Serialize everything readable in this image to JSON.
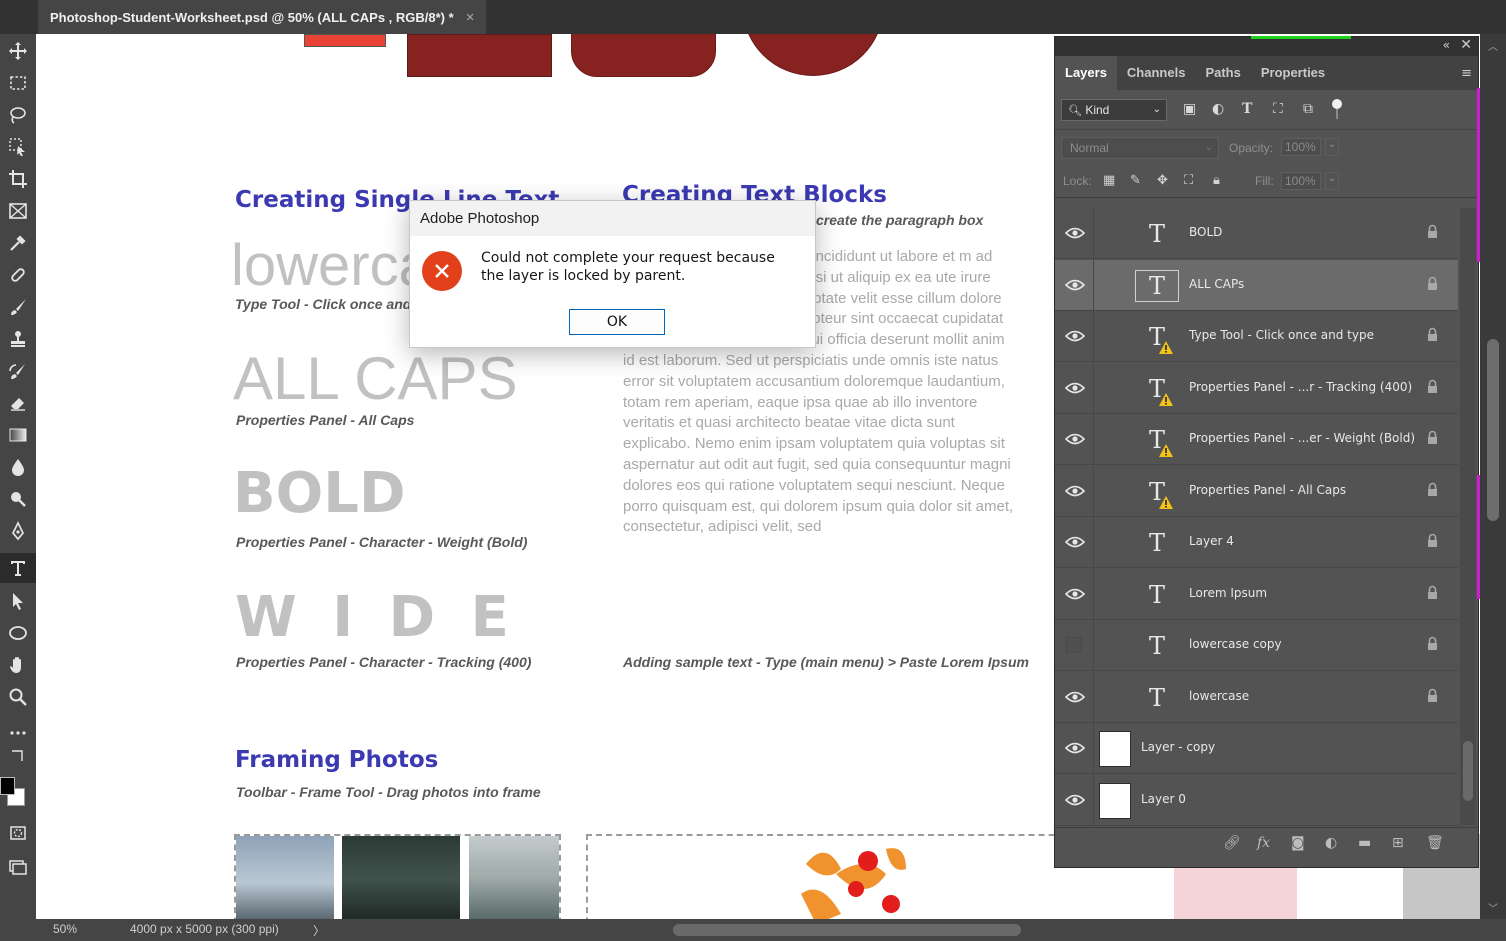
{
  "document_tab": {
    "title": "Photoshop-Student-Worksheet.psd @ 50% (ALL CAPs , RGB/8*) *",
    "close": "×"
  },
  "toolbar": {
    "tools": [
      "move-tool",
      "marquee-tool",
      "lasso-tool",
      "object-select-tool",
      "crop-tool",
      "frame-tool",
      "eyedropper-tool",
      "spot-healing-tool",
      "brush-tool",
      "clone-stamp-tool",
      "history-brush-tool",
      "eraser-tool",
      "gradient-tool",
      "blur-tool",
      "dodge-tool",
      "pen-tool",
      "type-tool",
      "path-select-tool",
      "ellipse-tool",
      "hand-tool",
      "zoom-tool",
      "more-tools",
      "swap-colors",
      "color-swatches",
      "quick-mask",
      "screen-mode"
    ],
    "active_tool": "type-tool"
  },
  "canvas": {
    "heading_single": "Creating Single Line Text",
    "heading_blocks": "Creating Text Blocks",
    "blocks_caption_top": "create the paragraph box",
    "sample_lowercase": "lowercase",
    "caption_type_tool": "Type Tool - Click once and type",
    "sample_allcaps": "ALL CAPS",
    "caption_allcaps": "Properties Panel - All Caps",
    "sample_bold": "BOLD",
    "caption_bold": "Properties Panel - Character - Weight (Bold)",
    "sample_wide": "W I D E",
    "caption_wide": "Properties Panel - Character - Tracking (400)",
    "lorem_text": "met, consectetur adipisicing incididunt ut labore et m ad minim veniam, quis laboris nisi ut aliquip ex ea ute irure dolor in reprehenderit in voluptate velit esse cillum dolore eu fugiat nulla pariatur. Excepteur sint occaecat cupidatat non proident, sunt in culpa qui officia deserunt mollit anim id est laborum. Sed ut perspiciatis unde omnis iste natus error sit voluptatem accusantium doloremque laudantium, totam rem aperiam, eaque ipsa quae ab illo inventore veritatis et quasi architecto beatae vitae dicta sunt explicabo. Nemo enim ipsam voluptatem quia voluptas sit aspernatur aut odit aut fugit, sed quia consequuntur magni dolores eos qui ratione voluptatem sequi nesciunt. Neque porro quisquam est, qui dolorem ipsum quia dolor sit amet, consectetur, adipisci velit, sed",
    "caption_lorem": "Adding sample text - Type (main menu) > Paste Lorem Ipsum",
    "heading_framing": "Framing Photos",
    "caption_framing": "Toolbar - Frame Tool - Drag photos into frame",
    "shape_color": "#862220",
    "heading_color": "#3b3ab2"
  },
  "dialog": {
    "title": "Adobe Photoshop",
    "message": "Could not complete your request because the layer is locked by parent.",
    "ok_label": "OK",
    "icon": "error-icon"
  },
  "layers_panel": {
    "tabs": [
      "Layers",
      "Channels",
      "Paths",
      "Properties"
    ],
    "active_tab": "Layers",
    "kind_label": "Kind",
    "blend_mode": "Normal",
    "opacity_label": "Opacity:",
    "opacity_value": "100%",
    "lock_label": "Lock:",
    "fill_label": "Fill:",
    "fill_value": "100%",
    "layers": [
      {
        "name": "BOLD",
        "type": "text",
        "visible": true,
        "warning": false,
        "selected": false,
        "locked": true
      },
      {
        "name": "ALL CAPs",
        "type": "text",
        "visible": true,
        "warning": false,
        "selected": true,
        "locked": true
      },
      {
        "name": "Type Tool - Click once and type",
        "type": "text",
        "visible": true,
        "warning": true,
        "selected": false,
        "locked": true
      },
      {
        "name": "Properties Panel - ...r - Tracking (400)",
        "type": "text",
        "visible": true,
        "warning": true,
        "selected": false,
        "locked": true
      },
      {
        "name": "Properties Panel - ...er - Weight (Bold)",
        "type": "text",
        "visible": true,
        "warning": true,
        "selected": false,
        "locked": true
      },
      {
        "name": "Properties Panel - All Caps",
        "type": "text",
        "visible": true,
        "warning": true,
        "selected": false,
        "locked": true
      },
      {
        "name": "Layer 4",
        "type": "text",
        "visible": true,
        "warning": false,
        "selected": false,
        "locked": true
      },
      {
        "name": "Lorem Ipsum",
        "type": "text",
        "visible": true,
        "warning": false,
        "selected": false,
        "locked": true
      },
      {
        "name": "lowercase copy",
        "type": "text",
        "visible": false,
        "warning": false,
        "selected": false,
        "locked": true
      },
      {
        "name": "lowercase",
        "type": "text",
        "visible": true,
        "warning": false,
        "selected": false,
        "locked": true
      },
      {
        "name": "Layer - copy",
        "type": "pixel",
        "visible": true,
        "warning": false,
        "selected": false,
        "locked": false
      },
      {
        "name": "Layer 0",
        "type": "pixel",
        "visible": true,
        "warning": false,
        "selected": false,
        "locked": false
      }
    ]
  },
  "status_bar": {
    "zoom": "50%",
    "doc_size": "4000 px x 5000 px (300 ppi)",
    "arrow": "〉"
  }
}
